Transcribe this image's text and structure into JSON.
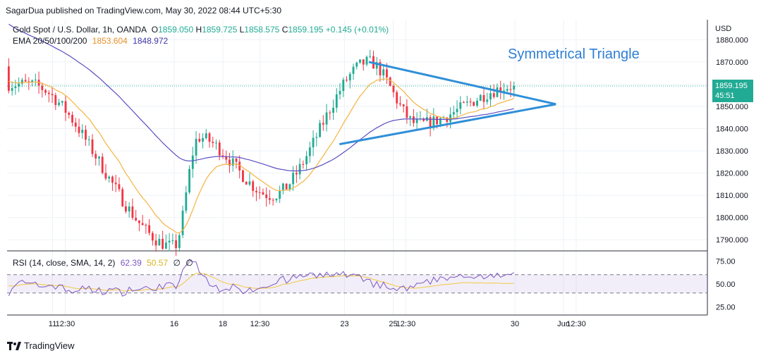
{
  "header": {
    "attribution": "SagarDua published on TradingView.com, May 30, 2022 08:44 UTC+5:30",
    "symbol": "Gold Spot / U.S. Dollar, 1h, OANDA",
    "open_label": "O",
    "open": "1859.050",
    "high_label": "H",
    "high": "1859.725",
    "low_label": "L",
    "low": "1858.575",
    "close_label": "C",
    "close": "1859.195",
    "change": "+0.145 (+0.01%)",
    "ema_label": "EMA 20/50/100/200",
    "ema_val_1": "1853.604",
    "ema_val_2": "1848.972",
    "rsi_label": "RSI (14, close, SMA, 14, 2)",
    "rsi_val": "62.39",
    "rsi_sma": "50.57",
    "rsi_n1": "∅",
    "rsi_n2": "∅"
  },
  "annotation": "Symmetrical Triangle",
  "price_badge": {
    "price": "1859.195",
    "countdown": "45:51"
  },
  "footer": {
    "brand": "TradingView",
    "logo_icon": "tradingview-logo-icon"
  },
  "colors": {
    "up": "#22ab94",
    "down": "#f23645",
    "ema_fast": "#f5b342",
    "ema_slow": "#5b4fc2",
    "trendline": "#2f8fd8",
    "rsi": "#7e57c2",
    "rsi_sma": "#f0c940",
    "grid": "#eef2f6"
  },
  "chart_data": [
    {
      "type": "candlestick",
      "title": "Gold Spot / U.S. Dollar, 1h, OANDA",
      "y_axis_label": "USD",
      "y_ticks": [
        "1880.000",
        "1870.000",
        "1860.000",
        "1850.000",
        "1840.000",
        "1830.000",
        "1820.000",
        "1810.000",
        "1800.000",
        "1790.000"
      ],
      "ylim": [
        1785,
        1889
      ],
      "x_ticks": [
        "11",
        "12:30",
        "16",
        "18",
        "12:30",
        "23",
        "25",
        "12:30",
        "30",
        "Jun",
        "12:30"
      ],
      "grid": true,
      "last_price": 1859.195,
      "series": [
        {
          "name": "EMA 20/50/100/200",
          "value_last": 1853.604
        },
        {
          "name": "",
          "value_last": 1848.972
        }
      ],
      "key_points": [
        {
          "x": "May 10",
          "y": 1860
        },
        {
          "x": "May 16",
          "y": 1787
        },
        {
          "x": "May 17",
          "y": 1836
        },
        {
          "x": "May 20",
          "y": 1810
        },
        {
          "x": "May 24",
          "y": 1870
        },
        {
          "x": "May 26",
          "y": 1842
        },
        {
          "x": "May 30",
          "y": 1859.195
        }
      ],
      "annotations": [
        {
          "text": "Symmetrical Triangle"
        },
        {
          "type": "trendline",
          "from": {
            "x": "May 24",
            "y": 1870
          },
          "to": {
            "x": "May 31 16:30",
            "y": 1851
          }
        },
        {
          "type": "trendline",
          "from": {
            "x": "May 22 19:00",
            "y": 1833
          },
          "to": {
            "x": "May 31 16:30",
            "y": 1851
          }
        }
      ]
    },
    {
      "type": "line",
      "title": "RSI (14, close, SMA, 14, 2)",
      "y_ticks": [
        "75.00",
        "50.00",
        "25.00"
      ],
      "ylim": [
        16,
        86
      ],
      "bands": [
        40,
        60
      ],
      "series": [
        {
          "name": "RSI (14, close, SMA, 14, 2)",
          "value_last": 62.39
        },
        {
          "name": "",
          "value_last": 50.57
        }
      ]
    }
  ]
}
